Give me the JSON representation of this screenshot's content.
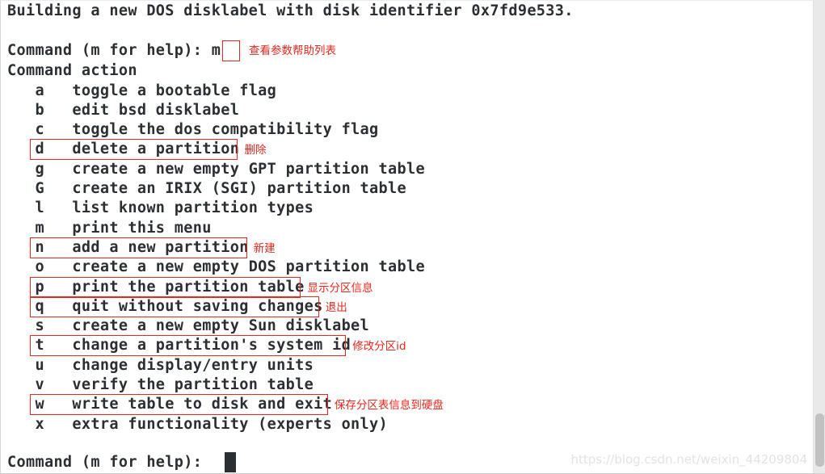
{
  "terminal": {
    "header_line": "Building a new DOS disklabel with disk identifier 0x7fd9e533.",
    "blank_line": "",
    "prompt_label": "Command (m for help): ",
    "prompt_entered_value": "m",
    "command_action_label": "Command action",
    "final_prompt_label": "Command (m for help): ",
    "cursor_glyph": "█"
  },
  "commands": [
    {
      "key": "a",
      "description": "toggle a bootable flag",
      "annotation": "",
      "highlighted": false
    },
    {
      "key": "b",
      "description": "edit bsd disklabel",
      "annotation": "",
      "highlighted": false
    },
    {
      "key": "c",
      "description": "toggle the dos compatibility flag",
      "annotation": "",
      "highlighted": false
    },
    {
      "key": "d",
      "description": "delete a partition",
      "annotation": "删除",
      "highlighted": true
    },
    {
      "key": "g",
      "description": "create a new empty GPT partition table",
      "annotation": "",
      "highlighted": false
    },
    {
      "key": "G",
      "description": "create an IRIX (SGI) partition table",
      "annotation": "",
      "highlighted": false
    },
    {
      "key": "l",
      "description": "list known partition types",
      "annotation": "",
      "highlighted": false
    },
    {
      "key": "m",
      "description": "print this menu",
      "annotation": "",
      "highlighted": false
    },
    {
      "key": "n",
      "description": "add a new partition",
      "annotation": "新建",
      "highlighted": true
    },
    {
      "key": "o",
      "description": "create a new empty DOS partition table",
      "annotation": "",
      "highlighted": false
    },
    {
      "key": "p",
      "description": "print the partition table",
      "annotation": "显示分区信息",
      "highlighted": true
    },
    {
      "key": "q",
      "description": "quit without saving changes",
      "annotation": "退出",
      "highlighted": true
    },
    {
      "key": "s",
      "description": "create a new empty Sun disklabel",
      "annotation": "",
      "highlighted": false
    },
    {
      "key": "t",
      "description": "change a partition's system id",
      "annotation": "修改分区id",
      "highlighted": true
    },
    {
      "key": "u",
      "description": "change display/entry units",
      "annotation": "",
      "highlighted": false
    },
    {
      "key": "v",
      "description": "verify the partition table",
      "annotation": "",
      "highlighted": false
    },
    {
      "key": "w",
      "description": "write table to disk and exit",
      "annotation": "保存分区表信息到硬盘",
      "highlighted": true
    },
    {
      "key": "x",
      "description": "extra functionality (experts only)",
      "annotation": "",
      "highlighted": false
    }
  ],
  "prompt_annotation": "查看参数帮助列表",
  "watermark": "https://blog.csdn.net/weixin_44209804",
  "colors": {
    "background": "#ffffff",
    "text": "#2b2f33",
    "highlight": "#e8281e",
    "watermark": "#e3e3e3",
    "scrollbar_track": "#e9e9e9",
    "scrollbar_thumb": "#c1c1c1"
  }
}
